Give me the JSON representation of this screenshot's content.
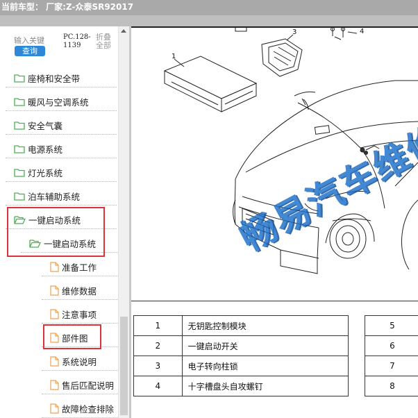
{
  "window": {
    "title": "当前车型： 厂家:Z-众泰SR92017"
  },
  "search": {
    "placeholder": "输入关键",
    "button_label": "查询",
    "pc_code_line1": "PC.128-",
    "pc_code_line2": "1139",
    "collapse_all_label": "折叠全部"
  },
  "tree": {
    "items": [
      {
        "label": "座椅和安全带"
      },
      {
        "label": "暖风与空调系统"
      },
      {
        "label": "安全气囊"
      },
      {
        "label": "电源系统"
      },
      {
        "label": "灯光系统"
      },
      {
        "label": "泊车辅助系统"
      },
      {
        "label": "一键启动系统"
      },
      {
        "label": "一键启动系统"
      },
      {
        "label": "准备工作"
      },
      {
        "label": "维修数据"
      },
      {
        "label": "注意事项"
      },
      {
        "label": "部件图"
      },
      {
        "label": "系统说明"
      },
      {
        "label": "售后匹配说明"
      },
      {
        "label": "故障检查排除"
      }
    ]
  },
  "diagram": {
    "callouts": [
      "1",
      "3",
      "4"
    ]
  },
  "parts_table": {
    "left": [
      {
        "no": "1",
        "desc": "无钥匙控制模块"
      },
      {
        "no": "2",
        "desc": "一键启动开关"
      },
      {
        "no": "3",
        "desc": "电子转向柱锁"
      },
      {
        "no": "4",
        "desc": "十字槽盘头自攻螺钉"
      }
    ],
    "right": [
      "5",
      "6",
      "7",
      "8"
    ]
  },
  "watermark": {
    "text": "畅易汽车维修"
  },
  "colors": {
    "highlight": "#d9343b",
    "folder_icon": "#4caf50",
    "document_icon": "#f0a24a",
    "button": "#2f87d8",
    "watermark": "#1a6fc9"
  }
}
